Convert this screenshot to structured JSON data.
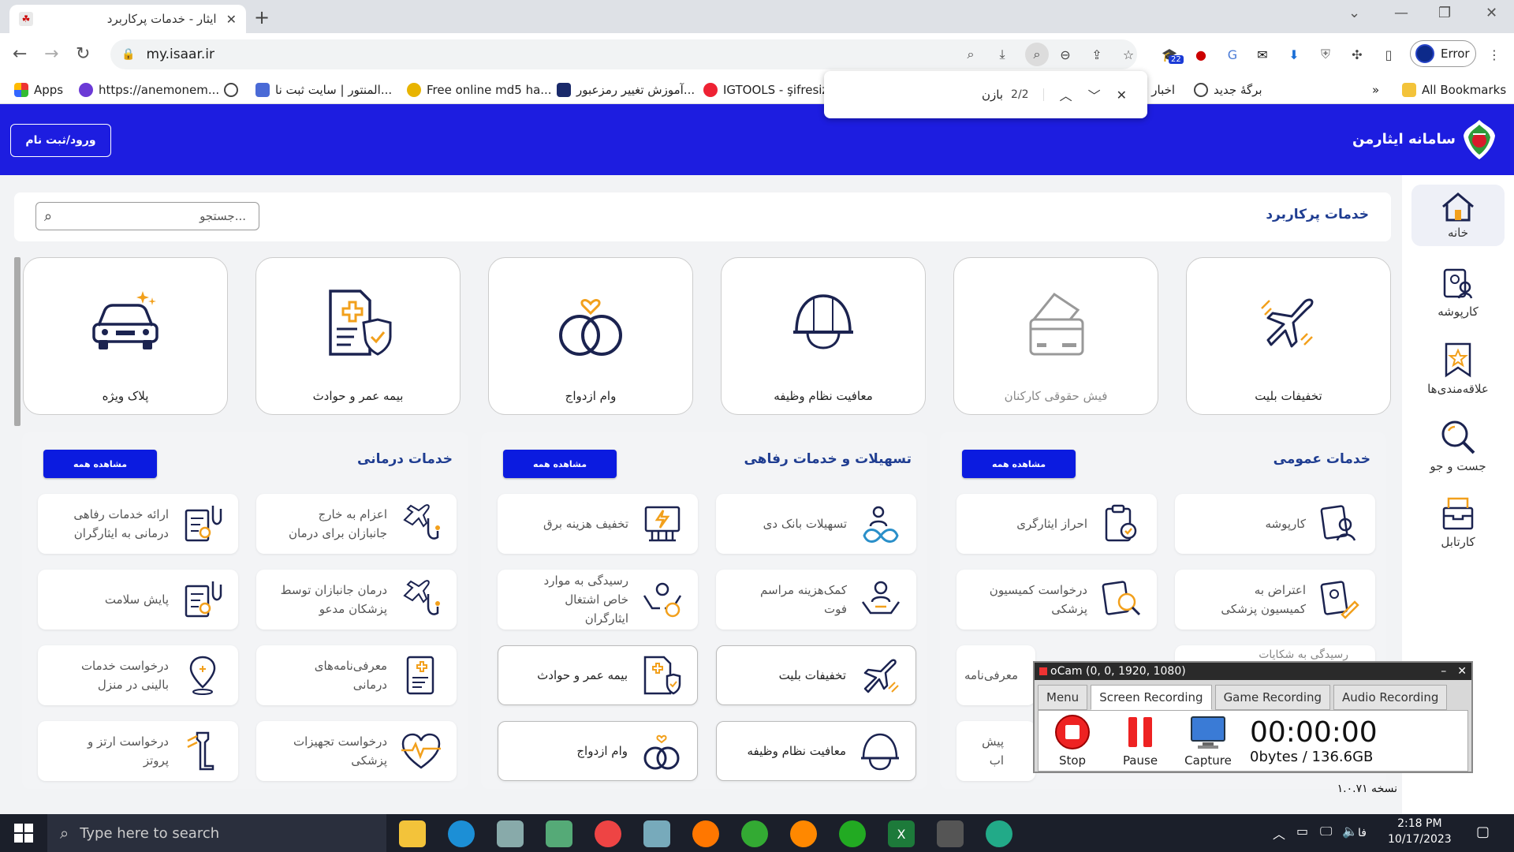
{
  "browser": {
    "tab_title": "ایثار - خدمات پرکاربرد",
    "url": "my.isaar.ir",
    "profile_label": "Error",
    "bookmarks": [
      "Apps",
      "https://anemonem...",
      "المنتور | سایت ثبت نا...",
      "Free online md5 ha...",
      "آموزش تغییر رمزعبور...",
      "IGTOOLS - şifresiz",
      "اخبار تل",
      "برگهٔ جدید",
      "All Bookmarks"
    ],
    "extension_badge": "22"
  },
  "find_bar": {
    "query": "بازن",
    "count": "2/2"
  },
  "header": {
    "login_label": "ورود/ثبت نام",
    "brand": "سامانه ایثارمن"
  },
  "sidebar": {
    "items": [
      {
        "label": "خانه",
        "icon": "home-icon"
      },
      {
        "label": "کارپوشه",
        "icon": "portfolio-icon"
      },
      {
        "label": "علاقه‌مندی‌ها",
        "icon": "bookmark-star-icon"
      },
      {
        "label": "جست و جو",
        "icon": "search-icon"
      },
      {
        "label": "کارتابل",
        "icon": "inbox-icon"
      }
    ]
  },
  "main": {
    "search_placeholder": "جستجو...",
    "section_title": "خدمات پرکاربرد",
    "cards": [
      {
        "label": "تخفیفات بلیت",
        "icon": "airplane-icon"
      },
      {
        "label": "فیش حقوقی کارکنان",
        "icon": "payslip-card-icon",
        "muted": true
      },
      {
        "label": "معافیت نظام وظیفه",
        "icon": "military-helmet-icon"
      },
      {
        "label": "وام ازدواج",
        "icon": "wedding-rings-icon"
      },
      {
        "label": "بیمه عمر و حوادث",
        "icon": "insurance-document-icon"
      },
      {
        "label": "پلاک ویژه",
        "icon": "car-icon"
      }
    ],
    "view_all_label": "مشاهده همه",
    "version": "نسخه ۱.۰.۷۱"
  },
  "panels": {
    "general": {
      "title": "خدمات عمومی",
      "items": [
        "کارپوشه",
        "احراز ایثارگری",
        "اعتراض به کمیسیون پزشکی",
        "درخواست کمیسیون پزشکی",
        "رسیدگی به شکایات",
        "معرفی‌نامه",
        "",
        "پیش اب"
      ]
    },
    "welfare": {
      "title": "تسهیلات و خدمات رفاهی",
      "items": [
        "تسهیلات بانک دی",
        "تخفیف هزینه برق",
        "کمک‌هزینه مراسم فوت",
        "رسیدگی به موارد خاص اشتغال ایثارگران",
        "تخفیفات بلیت",
        "بیمه عمر و حوادث",
        "معافیت نظام وظیفه",
        "وام ازدواج"
      ]
    },
    "medical": {
      "title": "خدمات درمانی",
      "items": [
        "اعزام به خارج جانبازان برای درمان",
        "ارائه خدمات رفاهی درمانی به ایثارگران",
        "درمان جانبازان توسط پزشکان مدعو",
        "پایش سلامت",
        "معرفی‌نامه‌های درمانی",
        "درخواست خدمات بالینی در منزل",
        "درخواست تجهیزات پزشکی",
        "درخواست ارتز و پروتز"
      ]
    }
  },
  "ocam": {
    "title": "oCam (0, 0, 1920, 1080)",
    "tabs": [
      "Menu",
      "Screen Recording",
      "Game Recording",
      "Audio Recording"
    ],
    "buttons": [
      "Stop",
      "Pause",
      "Capture"
    ],
    "timer": "00:00:00",
    "bytes": "0bytes / 136.6GB"
  },
  "taskbar": {
    "search_placeholder": "Type here to search",
    "time": "2:18 PM",
    "date": "10/17/2023",
    "lang": "فا"
  },
  "colors": {
    "header_blue": "#1d1de0",
    "button_blue": "#0b1be0",
    "title_blue": "#1f3d91",
    "icon_orange": "#f2a01c",
    "icon_navy": "#1b2350"
  }
}
